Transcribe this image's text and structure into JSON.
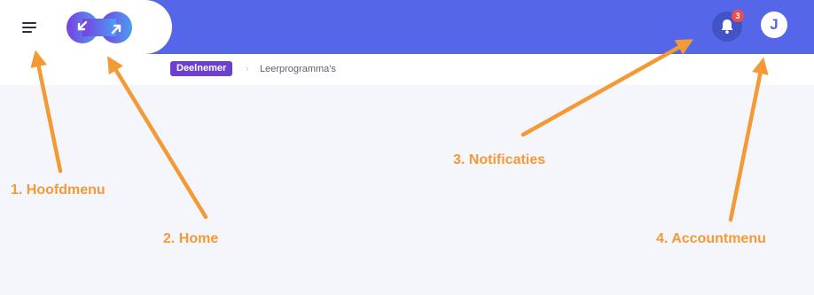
{
  "header": {
    "menu_icon": "hamburger-icon",
    "logo_icon": "infinity-arrows-logo",
    "notifications": {
      "icon": "bell-icon",
      "count": "3"
    },
    "account": {
      "initial": "J"
    }
  },
  "breadcrumb": {
    "role_chip": "Deelnemer",
    "separator": "›",
    "current": "Leerprogramma's"
  },
  "annotations": {
    "menu": "1. Hoofdmenu",
    "home": "2. Home",
    "notifications": "3. Notificaties",
    "account": "4. Accountmenu"
  },
  "colors": {
    "header": "#5566e8",
    "page_bg": "#f5f5fc",
    "chip": "#6c3fd1",
    "annotation": "#f39a36",
    "badge": "#ee4d4d"
  }
}
